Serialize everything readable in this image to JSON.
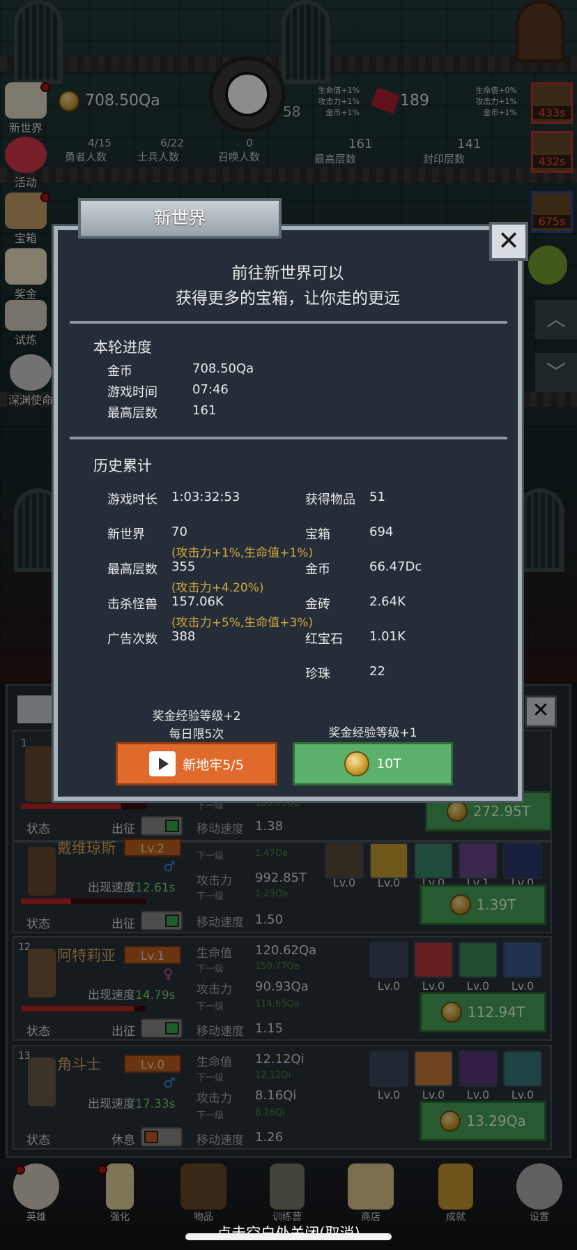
{
  "hud": {
    "coins": "708.50Qa",
    "gems": "189",
    "left_mods": [
      "生命值+1%",
      "攻击力+1%",
      "金币+1%"
    ],
    "right_mods": [
      "生命值+0%",
      "攻击力+1%",
      "金币+1%"
    ],
    "partial_num": "58",
    "stats": [
      {
        "value": "4/15",
        "label": "勇者人数"
      },
      {
        "value": "6/22",
        "label": "士兵人数"
      },
      {
        "value": "0",
        "label": "召唤人数"
      },
      {
        "value": "161",
        "label": "最高层数"
      },
      {
        "value": "141",
        "label": "封印层数"
      }
    ]
  },
  "left_menu": [
    "新世界",
    "活动",
    "宝箱",
    "奖金",
    "试炼",
    "深渊使命"
  ],
  "right_cards": [
    "433s",
    "432s",
    "675s"
  ],
  "modal": {
    "tab_title": "新世界",
    "close_label": "✕",
    "intro_line1": "前往新世界可以",
    "intro_line2": "获得更多的宝箱，让你走的更远",
    "round_title": "本轮进度",
    "round": [
      {
        "label": "金币",
        "value": "708.50Qa"
      },
      {
        "label": "游戏时间",
        "value": "07:46"
      },
      {
        "label": "最高层数",
        "value": "161"
      }
    ],
    "history_title": "历史累计",
    "history_left": [
      {
        "label": "游戏时长",
        "value": "1:03:32:53",
        "bonus": ""
      },
      {
        "label": "新世界",
        "value": "70",
        "bonus": "(攻击力+1%,生命值+1%)"
      },
      {
        "label": "最高层数",
        "value": "355",
        "bonus": "(攻击力+4.20%)"
      },
      {
        "label": "击杀怪兽",
        "value": "157.06K",
        "bonus": "(攻击力+5%,生命值+3%)"
      },
      {
        "label": "广告次数",
        "value": "388",
        "bonus": ""
      }
    ],
    "history_right": [
      {
        "label": "获得物品",
        "value": "51"
      },
      {
        "label": "宝箱",
        "value": "694"
      },
      {
        "label": "金币",
        "value": "66.47Dc"
      },
      {
        "label": "金砖",
        "value": "2.64K"
      },
      {
        "label": "红宝石",
        "value": "1.01K"
      },
      {
        "label": "珍珠",
        "value": "22"
      }
    ],
    "left_note1": "奖金经验等级+2",
    "left_note2": "每日限5次",
    "right_note": "奖金经验等级+1",
    "btn_ad_label": "新地牢5/5",
    "btn_coin_label": "10T"
  },
  "hero_list": {
    "row0": {
      "index": "1",
      "status": "状态",
      "deploy": "出征",
      "next_label": "下一级",
      "next_value": "105.53Qa",
      "speed_label": "移动速度",
      "speed": "1.38",
      "cost": "272.95T",
      "hp_fill": 0.8
    },
    "row1": {
      "name": "戴维琼斯",
      "lv": "Lv.2",
      "gender": "♂",
      "appear_label": "出现速度",
      "appear": "12.61s",
      "next1_label": "下一级",
      "next1": "1.47Qa",
      "atk_label": "攻击力",
      "atk": "992.85T",
      "next2_label": "下一级",
      "next2": "1.23Qa",
      "speed_label": "移动速度",
      "speed": "1.50",
      "status": "状态",
      "deploy": "出征",
      "cost": "1.39T",
      "skills": [
        "Lv.0",
        "Lv.0",
        "Lv.0",
        "Lv.1",
        "Lv.0"
      ],
      "hp_fill": 0.4
    },
    "row2": {
      "index": "12",
      "name": "阿特莉亚",
      "lv": "Lv.1",
      "gender": "♀",
      "appear_label": "出现速度",
      "appear": "14.79s",
      "hp_label": "生命值",
      "hp": "120.62Qa",
      "next1_label": "下一级",
      "next1": "150.77Qa",
      "atk_label": "攻击力",
      "atk": "90.93Qa",
      "next2_label": "下一级",
      "next2": "114.65Qa",
      "speed_label": "移动速度",
      "speed": "1.15",
      "status": "状态",
      "deploy": "出征",
      "cost": "112.94T",
      "skills": [
        "Lv.0",
        "Lv.0",
        "Lv.0",
        "Lv.0"
      ],
      "hp_fill": 0.9
    },
    "row3": {
      "index": "13",
      "name": "角斗士",
      "lv": "Lv.0",
      "gender": "♂",
      "appear_label": "出现速度",
      "appear": "17.33s",
      "hp_label": "生命值",
      "hp": "12.12Qi",
      "next1_label": "下一级",
      "next1": "12.12Qi",
      "atk_label": "攻击力",
      "atk": "8.16Qi",
      "next2_label": "下一级",
      "next2": "8.16Qi",
      "speed_label": "移动速度",
      "speed": "1.26",
      "status": "状态",
      "deploy": "休息",
      "cost": "13.29Qa",
      "skills": [
        "Lv.0",
        "Lv.0",
        "Lv.0",
        "Lv.0"
      ]
    }
  },
  "nav": [
    "英雄",
    "强化",
    "物品",
    "训练营",
    "商店",
    "成就",
    "设置"
  ],
  "bottom_hint": "点击空白处关闭(取消)"
}
